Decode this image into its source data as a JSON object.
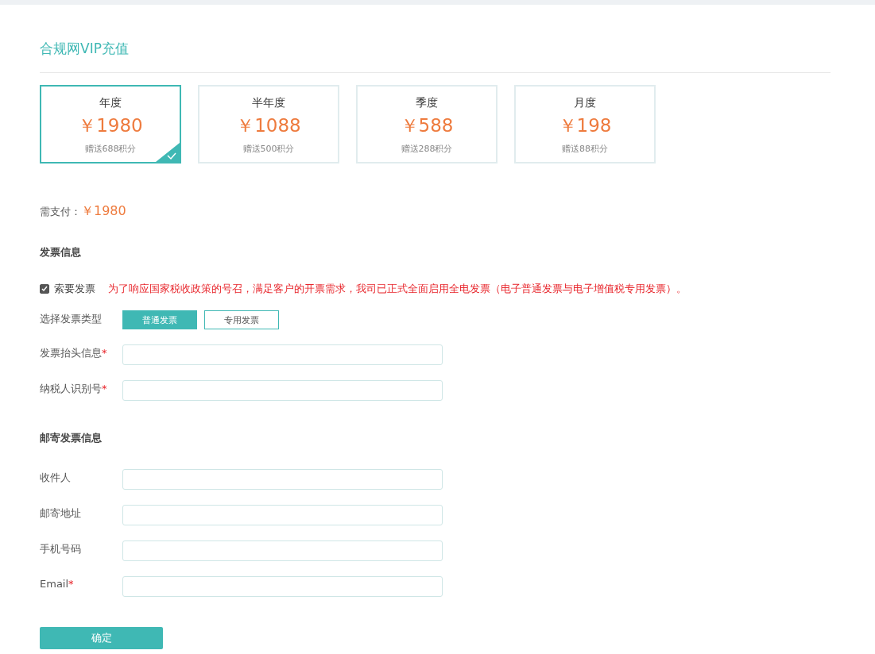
{
  "title": "合规网VIP充值",
  "plans": [
    {
      "name": "年度",
      "price": "￥1980",
      "bonus": "赠送688积分",
      "selected": true
    },
    {
      "name": "半年度",
      "price": "￥1088",
      "bonus": "赠送500积分",
      "selected": false
    },
    {
      "name": "季度",
      "price": "￥588",
      "bonus": "赠送288积分",
      "selected": false
    },
    {
      "name": "月度",
      "price": "￥198",
      "bonus": "赠送88积分",
      "selected": false
    }
  ],
  "payment": {
    "label": "需支付：",
    "amount": "￥1980"
  },
  "invoice": {
    "heading": "发票信息",
    "request": {
      "label": "索要发票",
      "checked": true
    },
    "notice": "为了响应国家税收政策的号召，满足客户的开票需求，我司已正式全面启用全电发票（电子普通发票与电子增值税专用发票）。",
    "type_label": "选择发票类型",
    "types": [
      {
        "label": "普通发票",
        "selected": true
      },
      {
        "label": "专用发票",
        "selected": false
      }
    ],
    "fields": [
      {
        "label": "发票抬头信息",
        "mark": "*"
      },
      {
        "label": "纳税人识别号",
        "mark": "*"
      }
    ]
  },
  "mailing": {
    "heading": "邮寄发票信息",
    "fields": [
      {
        "label": "收件人"
      },
      {
        "label": "邮寄地址"
      },
      {
        "label": "手机号码"
      },
      {
        "label": "Email",
        "mark": "*"
      }
    ]
  },
  "submit": "确定"
}
